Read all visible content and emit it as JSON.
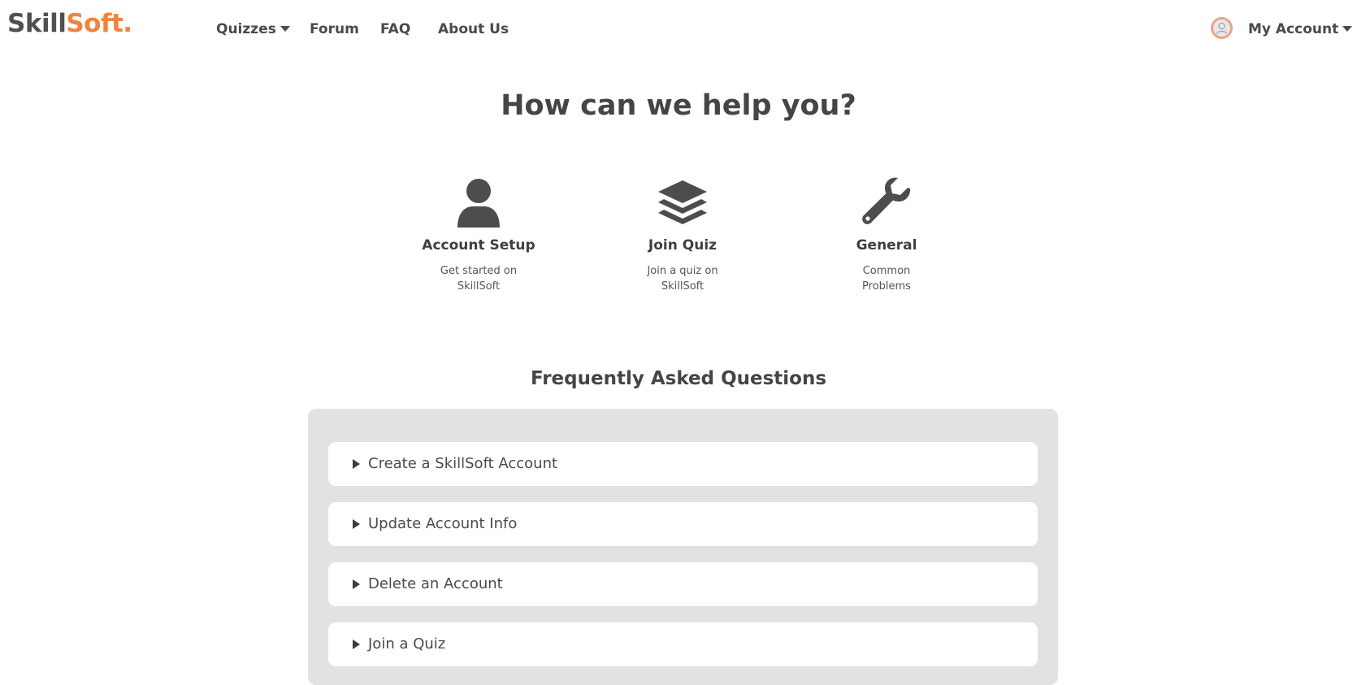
{
  "header": {
    "logo_part1": "Skill",
    "logo_part2": "Soft.",
    "nav": [
      "Quizzes",
      "Forum",
      "FAQ",
      "About Us"
    ],
    "account_label": "My Account"
  },
  "hero": {
    "title": "How can we help you?",
    "categories": [
      {
        "icon": "user-icon",
        "title": "Account Setup",
        "description": "Get started on SkillSoft"
      },
      {
        "icon": "layers-icon",
        "title": "Join Quiz",
        "description": "Join a quiz on SkillSoft"
      },
      {
        "icon": "wrench-icon",
        "title": "General",
        "description": "Common Problems"
      }
    ]
  },
  "faq": {
    "title": "Frequently Asked Questions",
    "items": [
      "Create a SkillSoft Account",
      "Update Account Info",
      "Delete an Account",
      "Join a Quiz"
    ]
  },
  "colors": {
    "brand_orange": "#f0843c",
    "text_dark": "#4a4a4a",
    "panel_gray": "#e2e2e2"
  }
}
